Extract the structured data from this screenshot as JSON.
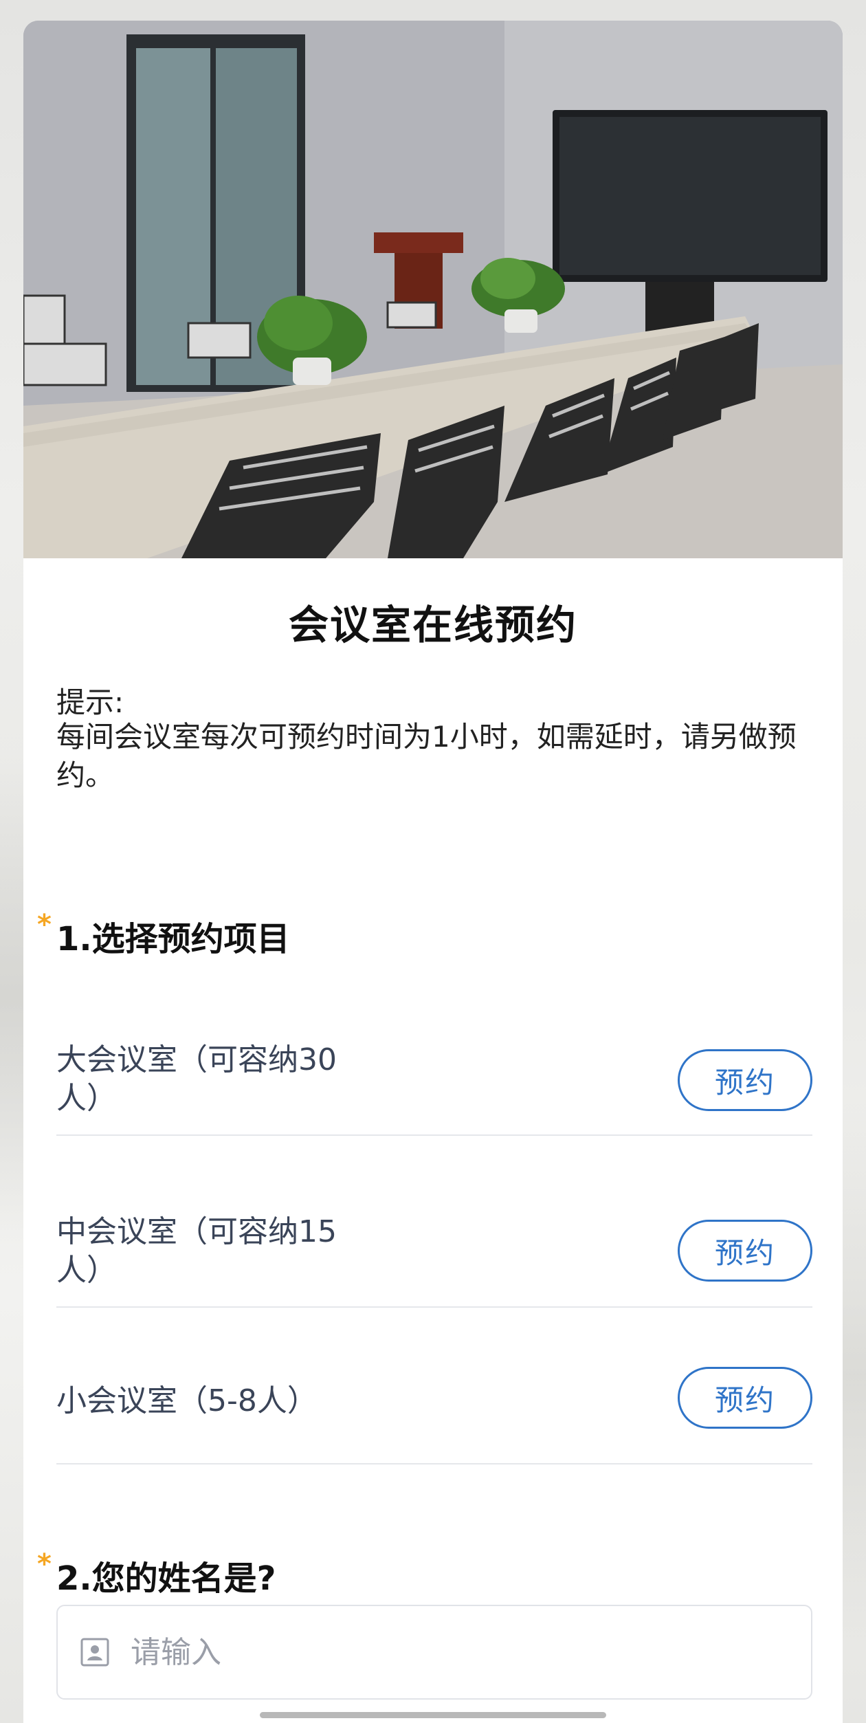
{
  "header": {
    "title": "会议室在线预约",
    "hint_label": "提示:",
    "hint_text": "每间会议室每次可预约时间为1小时，如需延时，请另做预约。"
  },
  "questions": [
    {
      "required_mark": "*",
      "title": "1.选择预约项目",
      "options": [
        {
          "label": "大会议室（可容纳30人）",
          "button": "预约"
        },
        {
          "label": "中会议室（可容纳15人）",
          "button": "预约"
        },
        {
          "label": "小会议室（5-8人）",
          "button": "预约"
        }
      ]
    },
    {
      "required_mark": "*",
      "title": "2.您的姓名是?",
      "input": {
        "placeholder": "请输入",
        "value": "",
        "icon": "contact-card-icon"
      }
    }
  ],
  "colors": {
    "accent": "#2f74c8",
    "required": "#f5a623",
    "option_text": "#3a4458"
  }
}
